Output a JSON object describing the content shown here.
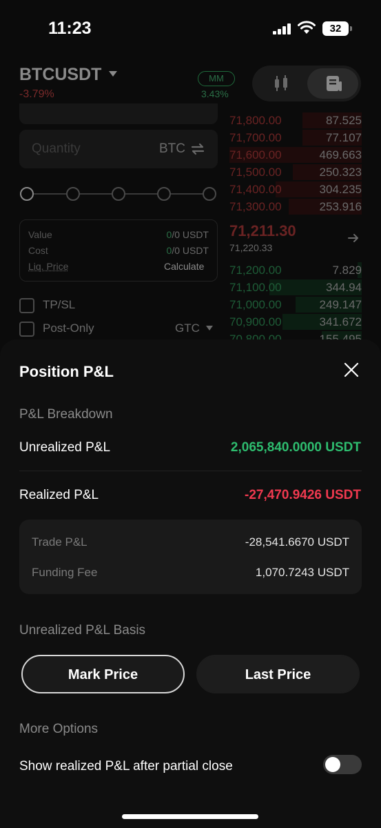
{
  "status_bar": {
    "time": "11:23",
    "battery": "32"
  },
  "header": {
    "pair": "BTCUSDT",
    "change": "-3.79%",
    "mm_label": "MM",
    "mm_value": "3.43%"
  },
  "order_form": {
    "quantity_placeholder": "Quantity",
    "quantity_unit": "BTC",
    "summary": [
      {
        "label": "Value",
        "value_colored": "0",
        "value_rest": "/0 USDT"
      },
      {
        "label": "Cost",
        "value_colored": "0",
        "value_rest": "/0 USDT"
      },
      {
        "label": "Liq. Price",
        "value_colored": "",
        "value_rest": "Calculate"
      }
    ],
    "tpsl_label": "TP/SL",
    "post_only_label": "Post-Only",
    "tif": "GTC"
  },
  "orderbook": {
    "asks": [
      {
        "price": "71,800.00",
        "qty": "87.525",
        "depth": 0.45
      },
      {
        "price": "71,700.00",
        "qty": "77.107",
        "depth": 0.45
      },
      {
        "price": "71,600.00",
        "qty": "469.663",
        "depth": 1.0
      },
      {
        "price": "71,500.00",
        "qty": "250.323",
        "depth": 0.52
      },
      {
        "price": "71,400.00",
        "qty": "304.235",
        "depth": 0.65
      },
      {
        "price": "71,300.00",
        "qty": "253.916",
        "depth": 0.55
      }
    ],
    "last_price": "71,211.30",
    "mark_price": "71,220.33",
    "bids": [
      {
        "price": "71,200.00",
        "qty": "7.829",
        "depth": 0.03
      },
      {
        "price": "71,100.00",
        "qty": "344.94",
        "depth": 0.7
      },
      {
        "price": "71,000.00",
        "qty": "249.147",
        "depth": 0.5
      },
      {
        "price": "70,900.00",
        "qty": "341.672",
        "depth": 0.6
      },
      {
        "price": "70,800.00",
        "qty": "155.495",
        "depth": 0.3
      }
    ]
  },
  "sheet": {
    "title": "Position P&L",
    "breakdown_label": "P&L Breakdown",
    "unrealized_label": "Unrealized P&L",
    "unrealized_value": "2,065,840.0000 USDT",
    "realized_label": "Realized P&L",
    "realized_value": "-27,470.9426 USDT",
    "details": [
      {
        "label": "Trade P&L",
        "value": "-28,541.6670 USDT"
      },
      {
        "label": "Funding Fee",
        "value": "1,070.7243 USDT"
      }
    ],
    "basis_label": "Unrealized P&L Basis",
    "basis_options": [
      "Mark Price",
      "Last Price"
    ],
    "more_options_label": "More Options",
    "toggle_label": "Show realized P&L after partial close",
    "toggle_on": false
  },
  "colors": {
    "positive": "#2ebd6f",
    "negative": "#f0394f",
    "sheet_bg": "#0f0f0f"
  }
}
